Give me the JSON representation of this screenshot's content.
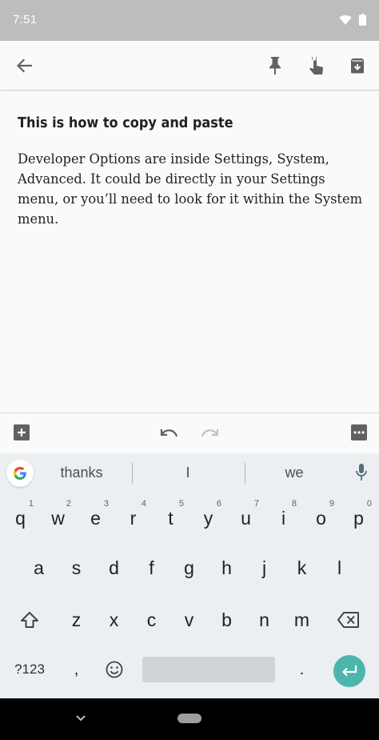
{
  "status_bar": {
    "time": "7:51"
  },
  "toolbar": {
    "icons": [
      "back-arrow-icon",
      "pin-icon",
      "touch-reminder-icon",
      "archive-icon"
    ]
  },
  "note": {
    "title": "This is how to copy and paste",
    "body": "Developer Options are inside Settings, System, Advanced. It could be directly in your Settings menu, or you’ll need to look for it within the System menu."
  },
  "edit_bar": {
    "icons": [
      "add-box-icon",
      "undo-icon",
      "redo-icon",
      "more-menu-icon"
    ]
  },
  "keyboard": {
    "suggestions": [
      "thanks",
      "I",
      "we"
    ],
    "row1": [
      {
        "k": "q",
        "h": "1"
      },
      {
        "k": "w",
        "h": "2"
      },
      {
        "k": "e",
        "h": "3"
      },
      {
        "k": "r",
        "h": "4"
      },
      {
        "k": "t",
        "h": "5"
      },
      {
        "k": "y",
        "h": "6"
      },
      {
        "k": "u",
        "h": "7"
      },
      {
        "k": "i",
        "h": "8"
      },
      {
        "k": "o",
        "h": "9"
      },
      {
        "k": "p",
        "h": "0"
      }
    ],
    "row2": [
      "a",
      "s",
      "d",
      "f",
      "g",
      "h",
      "j",
      "k",
      "l"
    ],
    "row3": [
      "z",
      "x",
      "c",
      "v",
      "b",
      "n",
      "m"
    ],
    "symbols_label": "?123",
    "comma": ",",
    "period": ".",
    "accent_color": "#4db6ac"
  }
}
